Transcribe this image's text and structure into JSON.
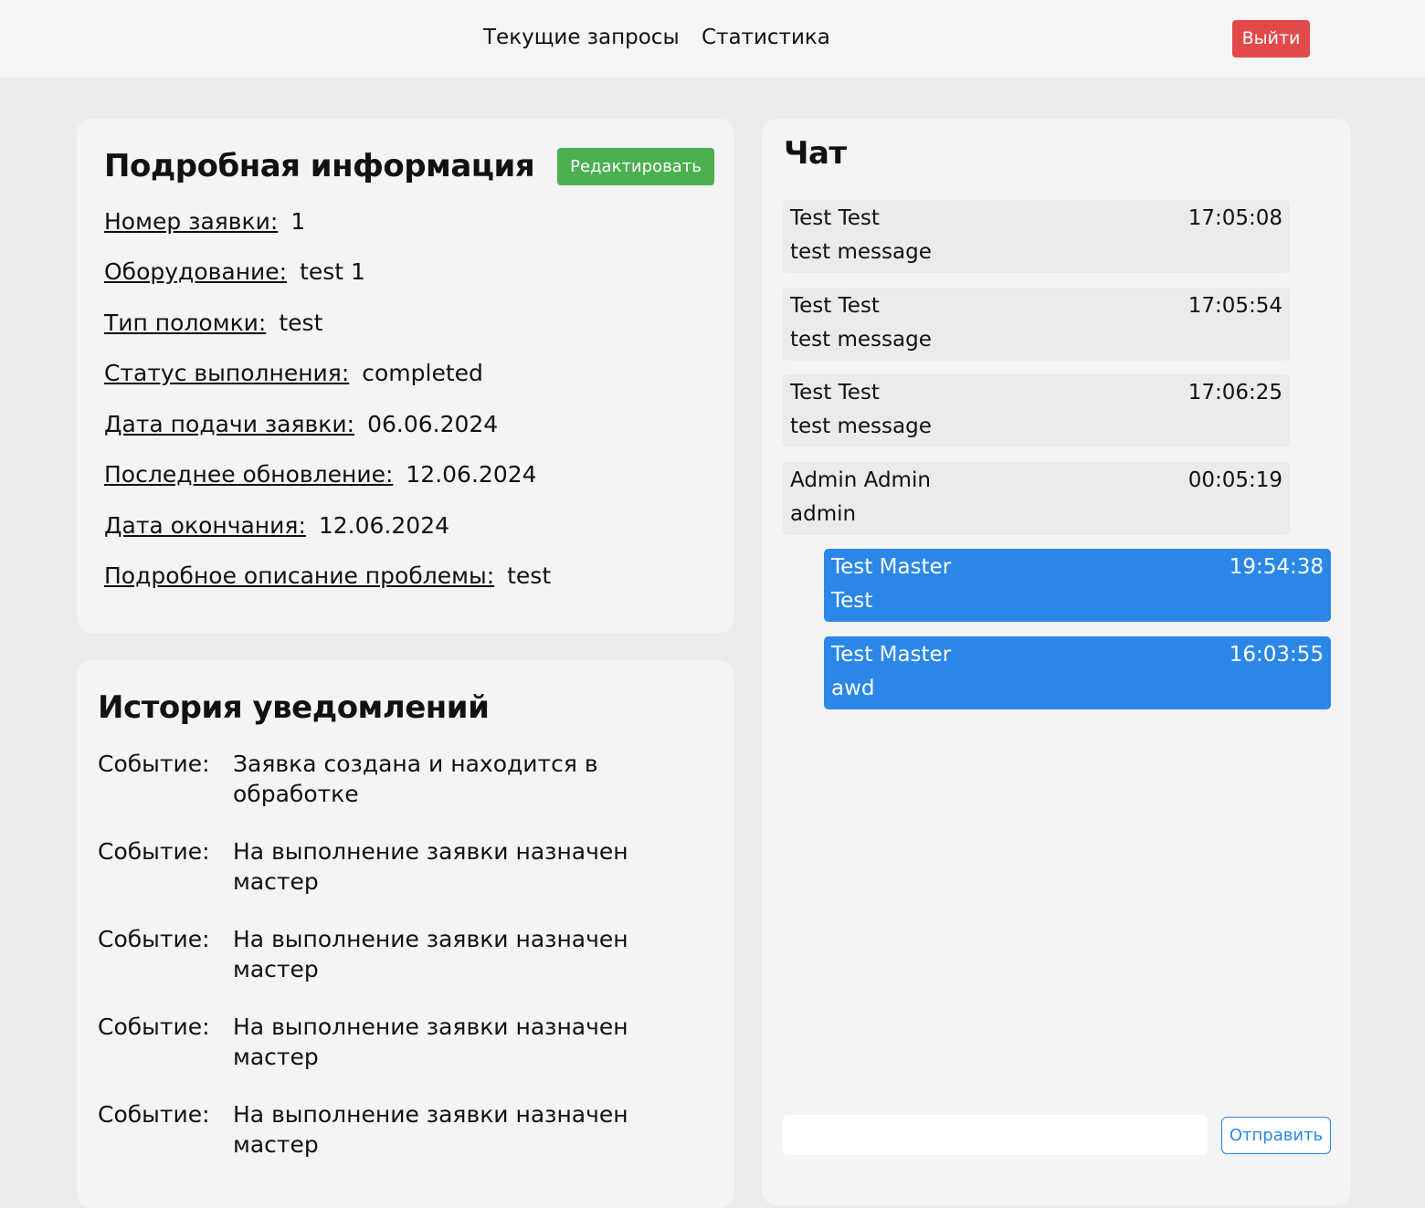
{
  "nav": {
    "current_requests": "Текущие запросы",
    "statistics": "Статистика",
    "logout": "Выйти"
  },
  "details": {
    "title": "Подробная информация",
    "edit_label": "Редактировать",
    "rows": [
      {
        "label": "Номер заявки:",
        "value": "1"
      },
      {
        "label": "Оборудование:",
        "value": "test 1"
      },
      {
        "label": "Тип поломки:",
        "value": "test"
      },
      {
        "label": "Статус выполнения:",
        "value": "completed"
      },
      {
        "label": "Дата подачи заявки:",
        "value": "06.06.2024"
      },
      {
        "label": "Последнее обновление:",
        "value": "12.06.2024"
      },
      {
        "label": "Дата окончания:",
        "value": "12.06.2024"
      },
      {
        "label": "Подробное описание проблемы:",
        "value": "test"
      }
    ]
  },
  "history": {
    "title": "История уведомлений",
    "events": [
      {
        "label": "Событие:",
        "text": "Заявка создана и находится в обработке"
      },
      {
        "label": "Событие:",
        "text": "На выполнение заявки назначен мастер"
      },
      {
        "label": "Событие:",
        "text": "На выполнение заявки назначен мастер"
      },
      {
        "label": "Событие:",
        "text": "На выполнение заявки назначен мастер"
      },
      {
        "label": "Событие:",
        "text": "На выполнение заявки назначен мастер"
      }
    ]
  },
  "chat": {
    "title": "Чат",
    "messages": [
      {
        "author": "Test Test",
        "time": "17:05:08",
        "text": "test message",
        "mine": false
      },
      {
        "author": "Test Test",
        "time": "17:05:54",
        "text": "test message",
        "mine": false
      },
      {
        "author": "Test Test",
        "time": "17:06:25",
        "text": "test message",
        "mine": false
      },
      {
        "author": "Admin Admin",
        "time": "00:05:19",
        "text": "admin",
        "mine": false
      },
      {
        "author": "Test Master",
        "time": "19:54:38",
        "text": "Test",
        "mine": true
      },
      {
        "author": "Test Master",
        "time": "16:03:55",
        "text": "awd",
        "mine": true
      }
    ],
    "input_value": "",
    "send_label": "Отправить"
  },
  "colors": {
    "logout": "#e24a4a",
    "edit": "#4caf50",
    "own_message": "#2a87e8"
  }
}
